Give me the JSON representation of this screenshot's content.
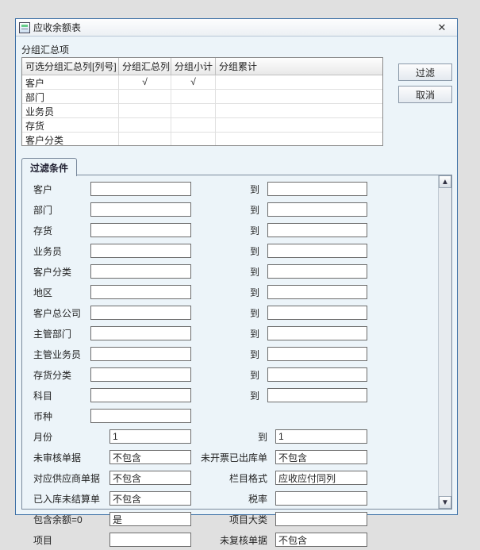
{
  "window": {
    "title": "应收余额表"
  },
  "group_label": "分组汇总项",
  "table": {
    "headers": {
      "col1": "可选分组汇总列[列号]",
      "col2": "分组汇总列",
      "col3": "分组小计",
      "col4": "分组累计"
    },
    "rows": [
      {
        "name": "客户",
        "col2": "√",
        "col3": "√",
        "col4": ""
      },
      {
        "name": "部门",
        "col2": "",
        "col3": "",
        "col4": ""
      },
      {
        "name": "业务员",
        "col2": "",
        "col3": "",
        "col4": ""
      },
      {
        "name": "存货",
        "col2": "",
        "col3": "",
        "col4": ""
      },
      {
        "name": "客户分类",
        "col2": "",
        "col3": "",
        "col4": ""
      }
    ]
  },
  "buttons": {
    "filter": "过滤",
    "cancel": "取消"
  },
  "tab": {
    "filters": "过滤条件"
  },
  "to": "到",
  "f": {
    "customer": "客户",
    "dept": "部门",
    "inv": "存货",
    "salesman": "业务员",
    "cust_cls": "客户分类",
    "region": "地区",
    "cust_head": "客户总公司",
    "mgr_dept": "主管部门",
    "mgr_sales": "主管业务员",
    "inv_cls": "存货分类",
    "subject": "科目",
    "currency": "币种",
    "month": "月份",
    "month_val": "1",
    "to_month_val": "1",
    "unapproved": "未审核单据",
    "supplier_doc": "对应供应商单据",
    "in_unsettle": "已入库未结算单",
    "inc_zero": "包含余额=0",
    "project": "项目",
    "not_invoiced_out": "未开票已出库单",
    "col_format": "栏目格式",
    "tax_rate": "税率",
    "proj_cat": "项目大类",
    "unreviewed": "未复核单据",
    "v_not_include": "不包含",
    "v_yes": "是",
    "v_col_format": "应收应付同列"
  },
  "glyph": {
    "up": "▲",
    "down": "▼",
    "close": "✕"
  }
}
